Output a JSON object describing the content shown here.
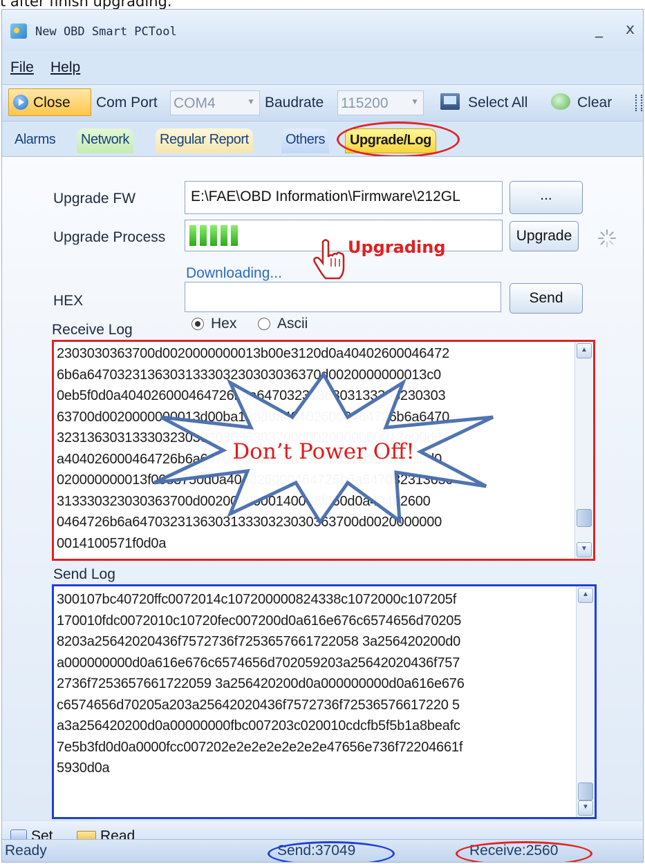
{
  "caption": "t after finish upgrading.",
  "window": {
    "title": "New OBD Smart PCTool",
    "minimize": "_",
    "close": "x"
  },
  "menu": {
    "file": "File",
    "help": "Help"
  },
  "toolbar": {
    "close_label": "Close",
    "com_port_label": "Com Port",
    "com_port_value": "COM4",
    "baudrate_label": "Baudrate",
    "baudrate_value": "115200",
    "select_all_label": "Select All",
    "clear_label": "Clear"
  },
  "tabs": [
    "Alarms",
    "Network",
    "Regular Report",
    "Others",
    "Upgrade/Log"
  ],
  "active_tab": "Upgrade/Log",
  "upgrade": {
    "fw_label": "Upgrade FW",
    "fw_path": "E:\\FAE\\OBD Information\\Firmware\\212GL",
    "browse_label": "...",
    "process_label": "Upgrade Process",
    "progress_blocks": 5,
    "upgrade_button": "Upgrade",
    "status_text": "Downloading...",
    "annotation": "Upgrading"
  },
  "hex": {
    "label": "HEX",
    "value": "",
    "send_button": "Send"
  },
  "receive_log": {
    "label": "Receive Log",
    "mode_hex": "Hex",
    "mode_ascii": "Ascii",
    "selected_mode": "Hex",
    "warning_annotation": "Don’t Power Off!",
    "lines": [
      "2303030363700d0020000000013b00e3120d0a40402600046472",
      "6b6a6470323136303133303230303036370d0020000000013c0",
      "0eb5f0d0a404026000464726b6a6470323136303133303230303",
      "63700d0020000000013d00ba130d0a404026000464726b6a6470",
      "32313630313330323030303636303700d0020000000013e00d0",
      "a404026000464726b6a647032313630313330323030363700d0",
      "020000000013f0083750d0a404026000464726b6a647032313630",
      "313330323030363700d0020000000140008f060d0a40402600",
      "0464726b6a647032313630313330323030363700d0020000000",
      "0014100571f0d0a"
    ]
  },
  "send_log": {
    "label": "Send Log",
    "lines": [
      "300107bc40720ffc0072014c107200000824338c1072000c107205f",
      "170010fdc0072010c10720fec007200d0a616e676c6574656d70205",
      "8203a25642020436f7572736f7253657661722058 3a256420200d0",
      "a000000000d0a616e676c6574656d702059203a25642020436f757",
      "2736f7253657661722059 3a256420200d0a000000000d0a616e676",
      "c6574656d70205a203a25642020436f7572736f72536576617220 5",
      "a3a256420200d0a00000000fbc007203c020010cdcfb5f5b1a8beafc",
      "7e5b3fd0d0a0000fcc007202e2e2e2e2e2e2e47656e736f72204661f",
      "5930d0a"
    ]
  },
  "footer": {
    "set_label": "Set",
    "read_label": "Read"
  },
  "status": {
    "ready": "Ready",
    "send": "Send:37049",
    "receive": "Receive:2560"
  },
  "colors": {
    "receive_border": "#e02424",
    "send_border": "#1f3fd6",
    "progress": "#3fc22a",
    "annotation_red": "#e02020"
  }
}
